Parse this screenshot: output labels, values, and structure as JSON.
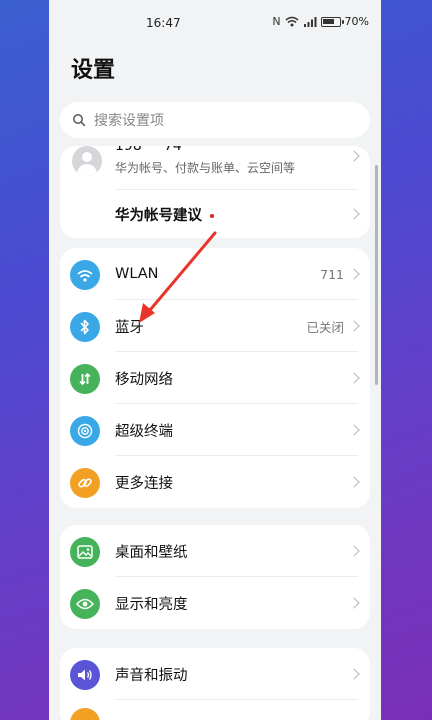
{
  "status": {
    "time": "16:47",
    "battery": "70%",
    "battery_level": 0.7
  },
  "page": {
    "title": "设置"
  },
  "search": {
    "placeholder": "搜索设置项"
  },
  "account": {
    "name_partial": "198 ··· 74",
    "subtitle": "华为帐号、付款与账单、云空间等",
    "suggestion_label": "华为帐号建议"
  },
  "connections": [
    {
      "label": "WLAN",
      "value": "711",
      "icon": "wifi-icon",
      "color": "#3aa7e6"
    },
    {
      "label": "蓝牙",
      "value": "已关闭",
      "icon": "bluetooth-icon",
      "color": "#3aa7e6"
    },
    {
      "label": "移动网络",
      "value": "",
      "icon": "mobile-network-icon",
      "color": "#46b35a"
    },
    {
      "label": "超级终端",
      "value": "",
      "icon": "super-device-icon",
      "color": "#3aa7e6"
    },
    {
      "label": "更多连接",
      "value": "",
      "icon": "link-icon",
      "color": "#f2a024"
    }
  ],
  "display": [
    {
      "label": "桌面和壁纸",
      "icon": "wallpaper-icon",
      "color": "#46b35a"
    },
    {
      "label": "显示和亮度",
      "icon": "eye-icon",
      "color": "#46b35a"
    }
  ],
  "sound": [
    {
      "label": "声音和振动",
      "icon": "speaker-icon",
      "color": "#5a55d6"
    }
  ]
}
